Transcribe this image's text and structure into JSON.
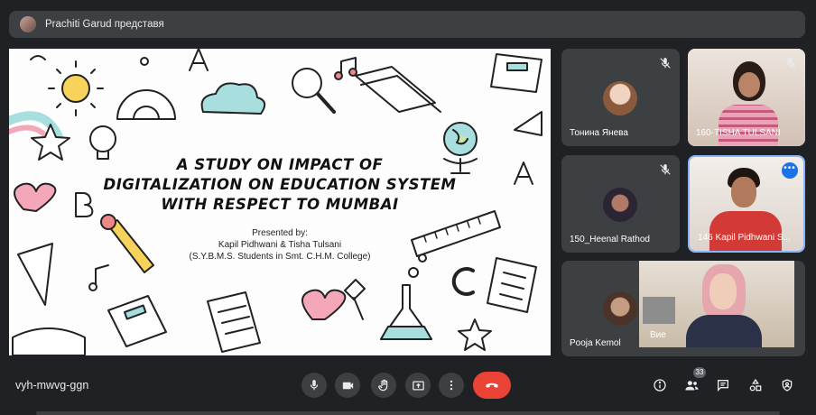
{
  "presenter_bar": {
    "text": "Prachiti Garud представя"
  },
  "slide": {
    "title_lines": [
      "A STUDY ON IMPACT OF",
      "DIGITALIZATION ON EDUCATION SYSTEM",
      "WITH RESPECT TO MUMBAI"
    ],
    "presented_by": "Presented by:",
    "authors": "Kapil Pidhwani & Tisha Tulsani",
    "affiliation": "(S.Y.B.M.S. Students in Smt. C.H.M. College)"
  },
  "participants": [
    {
      "name": "Тонина Янева",
      "muted": true
    },
    {
      "name": "160-TISHA TULSANI",
      "muted": true
    },
    {
      "name": "150_Heenal Rathod",
      "muted": true
    },
    {
      "name": "146 Kapil Pidhwani S...",
      "muted": false,
      "speaking": true
    },
    {
      "name": "Pooja Kemol",
      "self_label": "Вие"
    }
  ],
  "bottom_bar": {
    "meeting_code": "vyh-mwvg-ggn",
    "participant_count": "33"
  },
  "colors": {
    "background": "#202124",
    "tile": "#3c4043",
    "end_call": "#ea4335",
    "accent": "#8ab4f8"
  }
}
